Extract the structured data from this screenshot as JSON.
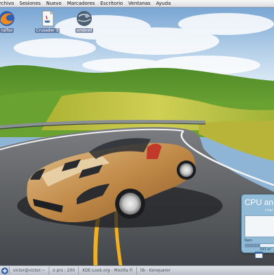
{
  "menubar": {
    "items": [
      "rchivo",
      "Sesiones",
      "Nuevo",
      "Marcadores",
      "Escritorio",
      "Ventanas",
      "Ayuda"
    ]
  },
  "desktop": {
    "icons": [
      {
        "label": "ralfox",
        "icon": "firefox-icon"
      },
      {
        "label": "Crusader 3",
        "icon": "java-document-icon"
      },
      {
        "label": "umbrell",
        "icon": "globe-icon"
      }
    ]
  },
  "wallpaper": {
    "subject": "sports-car-on-country-road",
    "sky": "#8fb8e0",
    "hills": "#5e9b2e",
    "road": "#5a5d62",
    "car": "#c9934f"
  },
  "cpu_widget": {
    "title": "CPU an",
    "subtitle": "Inter",
    "ram_label": "Ram",
    "ram_value": "343 of",
    "ram_fraction": 0.45
  },
  "taskbar": {
    "items": [
      "victor@victor:~",
      "o prs : 200",
      "KDE-Look.org - Mozilla Fi",
      "lib - Konqueror"
    ]
  },
  "colors": {
    "menubar_bg": "#e8e9ec",
    "widget_bg": "#96c3e1",
    "taskbar_bg": "#cfd3da"
  }
}
